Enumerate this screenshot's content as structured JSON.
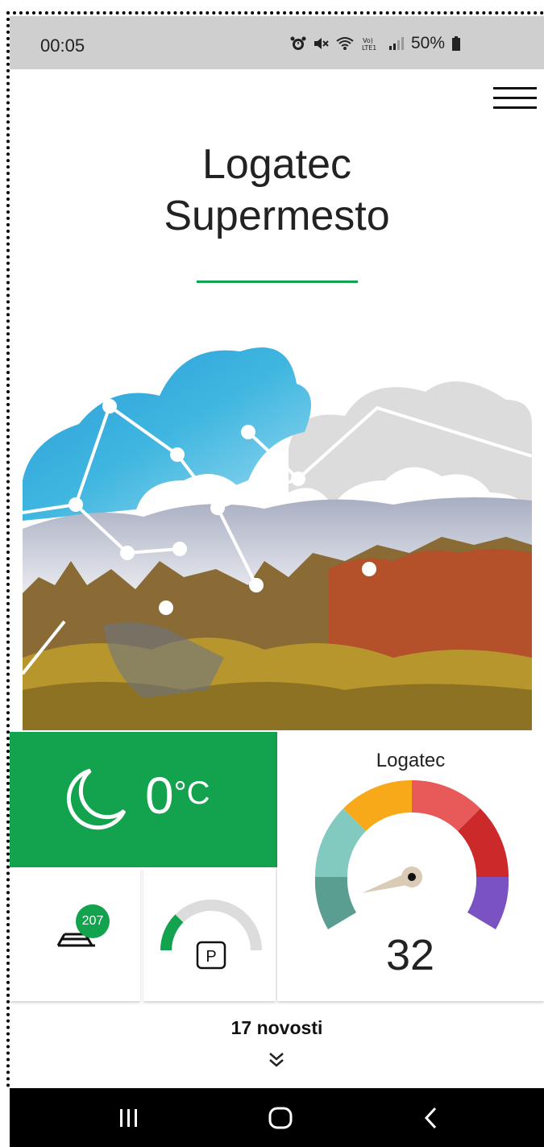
{
  "status_bar": {
    "time": "00:05",
    "battery": "50%"
  },
  "header": {
    "title_line1": "Logatec",
    "title_line2": "Supermesto"
  },
  "weather": {
    "temperature": "0",
    "unit": "°C",
    "icon": "moon-icon",
    "bg_color": "#13a24d"
  },
  "air_quality": {
    "location": "Logatec",
    "value": "32"
  },
  "bikes": {
    "count": "207",
    "icon": "bike-icon"
  },
  "parking": {
    "label": "P",
    "occupancy_fraction": 0.25
  },
  "news": {
    "label": "17 novosti"
  },
  "colors": {
    "accent": "#13a24d"
  }
}
